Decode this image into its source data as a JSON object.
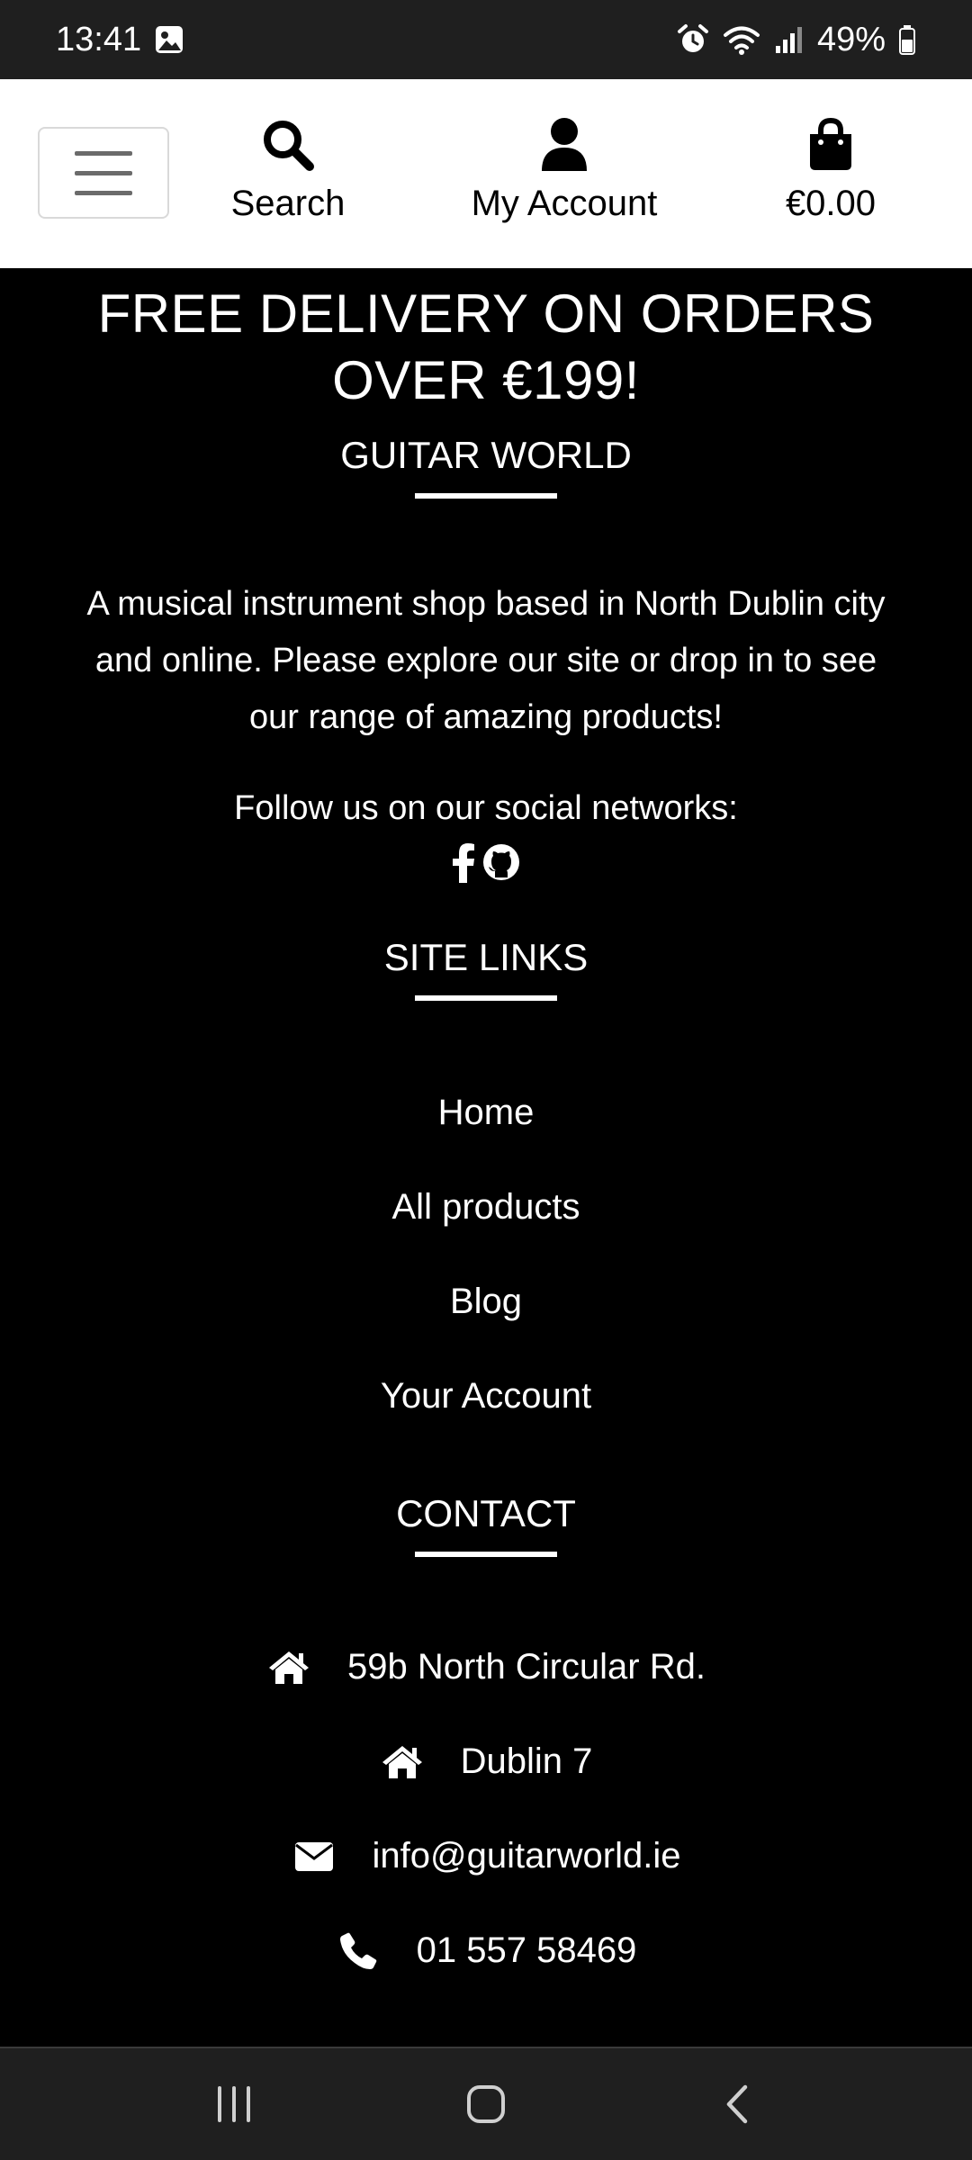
{
  "status_bar": {
    "time": "13:41",
    "battery": "49%",
    "icons": [
      "gallery-icon",
      "alarm-icon",
      "wifi-icon",
      "signal-icon",
      "battery-icon"
    ]
  },
  "nav": {
    "search_label": "Search",
    "account_label": "My Account",
    "bag_total": "€0.00",
    "icons": [
      "menu-icon",
      "search-icon",
      "user-icon",
      "shopping-bag-icon"
    ]
  },
  "banner": {
    "line1": "FREE DELIVERY ON ORDERS",
    "line2": "OVER €199!"
  },
  "about": {
    "title": "GUITAR WORLD",
    "text": "A musical instrument shop based in North Dublin city and online. Please explore our site or drop in to see our range of amazing products!",
    "follow_text": "Follow us on our social networks:",
    "social_icons": [
      "facebook-icon",
      "github-icon"
    ]
  },
  "site_links": {
    "title": "SITE LINKS",
    "items": [
      {
        "label": "Home"
      },
      {
        "label": "All products"
      },
      {
        "label": "Blog"
      },
      {
        "label": "Your Account"
      }
    ]
  },
  "contact": {
    "title": "CONTACT",
    "items": [
      {
        "icon": "home-icon",
        "text": "59b North Circular Rd."
      },
      {
        "icon": "home-icon",
        "text": "Dublin 7"
      },
      {
        "icon": "envelope-icon",
        "text": "info@guitarworld.ie"
      },
      {
        "icon": "phone-icon",
        "text": "01 557 58469"
      }
    ]
  },
  "colors": {
    "background": "#000000",
    "nav_background": "#ffffff",
    "system_bar": "#1f1f1f",
    "text": "#ffffff"
  }
}
